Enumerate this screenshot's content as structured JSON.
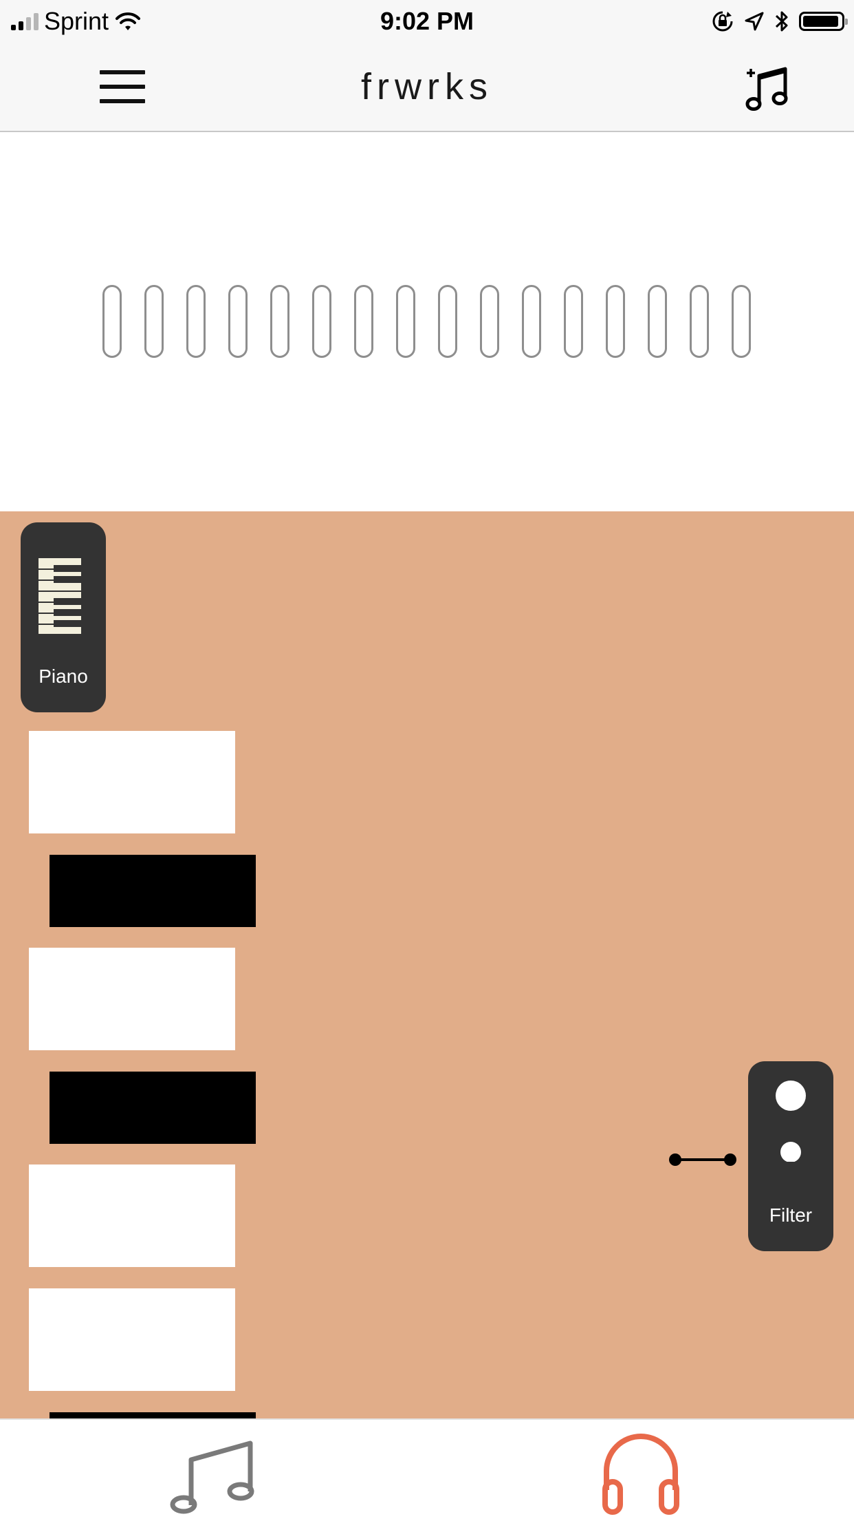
{
  "status_bar": {
    "carrier": "Sprint",
    "time": "9:02 PM"
  },
  "nav": {
    "title": "frwrks",
    "menu_icon": "hamburger-menu-icon",
    "add_song_icon": "add-music-note-icon"
  },
  "sequencer": {
    "step_count": 16
  },
  "instrument": {
    "label": "Piano",
    "icon": "piano-keys-icon"
  },
  "keyboard": {
    "keys": [
      "white",
      "black",
      "white",
      "black",
      "white",
      "white",
      "black"
    ]
  },
  "effect": {
    "label": "Filter"
  },
  "tabs": [
    {
      "name": "compose",
      "icon": "music-note-icon",
      "active": false
    },
    {
      "name": "listen",
      "icon": "headphones-icon",
      "active": true
    }
  ],
  "colors": {
    "stage_bg": "#e1ad89",
    "card_bg": "#333333",
    "accent": "#e8694a",
    "inactive_tab": "#7a7a7a"
  }
}
